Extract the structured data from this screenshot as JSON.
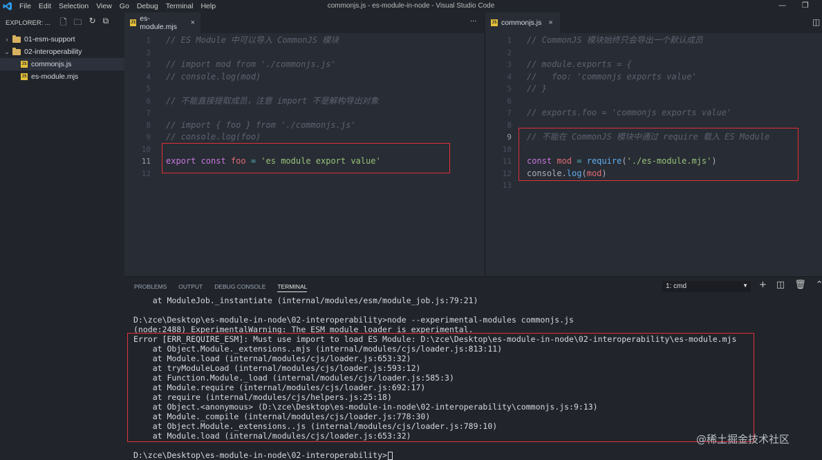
{
  "menu": [
    "File",
    "Edit",
    "Selection",
    "View",
    "Go",
    "Debug",
    "Terminal",
    "Help"
  ],
  "window_title": "commonjs.js - es-module-in-node - Visual Studio Code",
  "window_controls": {
    "minimize": "—",
    "restore": "❐"
  },
  "sidebar": {
    "header": "EXPLORER: ...",
    "items": [
      {
        "label": "01-esm-support",
        "type": "folder",
        "expanded": false
      },
      {
        "label": "02-interoperability",
        "type": "folder",
        "expanded": true
      },
      {
        "label": "commonjs.js",
        "type": "file",
        "selected": true
      },
      {
        "label": "es-module.mjs",
        "type": "file",
        "selected": false
      }
    ]
  },
  "left_editor": {
    "tab": "es-module.mjs",
    "more": "···",
    "lines": [
      [
        [
          "cm",
          "// ES Module 中可以导入 CommonJS 模块"
        ]
      ],
      [],
      [
        [
          "cm",
          "// import mod from './commonjs.js'"
        ]
      ],
      [
        [
          "cm",
          "// console.log(mod)"
        ]
      ],
      [],
      [
        [
          "cm",
          "// 不能直接提取成员，注意 import 不是解构导出对象"
        ]
      ],
      [],
      [
        [
          "cm",
          "// import { foo } from './commonjs.js'"
        ]
      ],
      [
        [
          "cm",
          "// console.log(foo)"
        ]
      ],
      [],
      [
        [
          "kw",
          "export "
        ],
        [
          "kw",
          "const "
        ],
        [
          "var",
          "foo"
        ],
        [
          "op",
          " = "
        ],
        [
          "str",
          "'es module export value'"
        ]
      ],
      []
    ]
  },
  "right_editor": {
    "tab": "commonjs.js",
    "lines": [
      [
        [
          "cm",
          "// CommonJS 模块始终只会导出一个默认成员"
        ]
      ],
      [],
      [
        [
          "cm",
          "// module.exports = {"
        ]
      ],
      [
        [
          "cm",
          "//   foo: 'commonjs exports value'"
        ]
      ],
      [
        [
          "cm",
          "// }"
        ]
      ],
      [],
      [
        [
          "cm",
          "// exports.foo = 'commonjs exports value'"
        ]
      ],
      [],
      [
        [
          "cm",
          "// 不能在 CommonJS 模块中通过 require 载入 ES Module"
        ]
      ],
      [],
      [
        [
          "kw",
          "const "
        ],
        [
          "var",
          "mod"
        ],
        [
          "op",
          " = "
        ],
        [
          "fn",
          "require"
        ],
        [
          "pl",
          "("
        ],
        [
          "str",
          "'./es-module.mjs'"
        ],
        [
          "pl",
          ")"
        ]
      ],
      [
        [
          "pl",
          "console."
        ],
        [
          "fn",
          "log"
        ],
        [
          "pl",
          "("
        ],
        [
          "var",
          "mod"
        ],
        [
          "pl",
          ")"
        ]
      ],
      []
    ]
  },
  "panel": {
    "tabs": [
      "PROBLEMS",
      "OUTPUT",
      "DEBUG CONSOLE",
      "TERMINAL"
    ],
    "active_tab": "TERMINAL",
    "terminal_select": "1: cmd",
    "actions": [
      "+",
      "◫",
      "🗑",
      "⌃"
    ],
    "lines": [
      "    at ModuleJob._instantiate (internal/modules/esm/module_job.js:79:21)",
      "",
      "D:\\zce\\Desktop\\es-module-in-node\\02-interoperability>node --experimental-modules commonjs.js",
      "(node:2488) ExperimentalWarning: The ESM module loader is experimental.",
      "Error [ERR_REQUIRE_ESM]: Must use import to load ES Module: D:\\zce\\Desktop\\es-module-in-node\\02-interoperability\\es-module.mjs",
      "    at Object.Module._extensions..mjs (internal/modules/cjs/loader.js:813:11)",
      "    at Module.load (internal/modules/cjs/loader.js:653:32)",
      "    at tryModuleLoad (internal/modules/cjs/loader.js:593:12)",
      "    at Function.Module._load (internal/modules/cjs/loader.js:585:3)",
      "    at Module.require (internal/modules/cjs/loader.js:692:17)",
      "    at require (internal/modules/cjs/helpers.js:25:18)",
      "    at Object.<anonymous> (D:\\zce\\Desktop\\es-module-in-node\\02-interoperability\\commonjs.js:9:13)",
      "    at Module._compile (internal/modules/cjs/loader.js:778:30)",
      "    at Object.Module._extensions..js (internal/modules/cjs/loader.js:789:10)",
      "    at Module.load (internal/modules/cjs/loader.js:653:32)",
      "",
      "D:\\zce\\Desktop\\es-module-in-node\\02-interoperability>"
    ]
  },
  "watermark": "@稀土掘金技术社区",
  "colors": {
    "highlight_box": "#e0303a",
    "editor_bg": "#282c34",
    "sidebar_bg": "#21252b"
  }
}
